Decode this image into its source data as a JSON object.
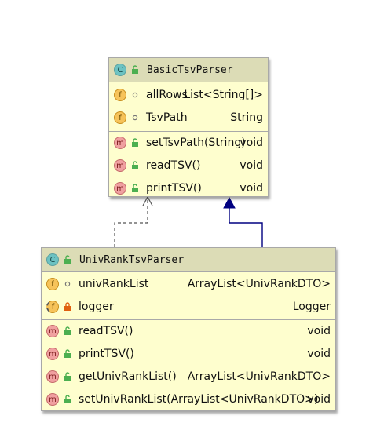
{
  "classes": {
    "basic": {
      "kind": "C",
      "name": "BasicTsvParser",
      "fields": [
        {
          "badge": "f",
          "visibility": "package",
          "name": "allRows",
          "type": "List<String[]>"
        },
        {
          "badge": "f",
          "visibility": "package",
          "name": "TsvPath",
          "type": "String"
        }
      ],
      "methods": [
        {
          "badge": "m",
          "visibility": "public",
          "name": "setTsvPath(String)",
          "type": "void"
        },
        {
          "badge": "m",
          "visibility": "public",
          "name": "readTSV()",
          "type": "void"
        },
        {
          "badge": "m",
          "visibility": "public",
          "name": "printTSV()",
          "type": "void"
        }
      ]
    },
    "univ": {
      "kind": "C",
      "name": "UnivRankTsvParser",
      "fields": [
        {
          "badge": "f",
          "visibility": "package",
          "name": "univRankList",
          "type": "ArrayList<UnivRankDTO>"
        },
        {
          "badge": "f",
          "visibility": "private",
          "static": true,
          "name": "logger",
          "type": "Logger"
        }
      ],
      "methods": [
        {
          "badge": "m",
          "visibility": "public",
          "name": "readTSV()",
          "type": "void"
        },
        {
          "badge": "m",
          "visibility": "public",
          "name": "printTSV()",
          "type": "void"
        },
        {
          "badge": "m",
          "visibility": "public",
          "name": "getUnivRankList()",
          "type": "ArrayList<UnivRankDTO>"
        },
        {
          "badge": "m",
          "visibility": "public",
          "name": "setUnivRankList(ArrayList<UnivRankDTO>)",
          "type": "void"
        }
      ]
    }
  },
  "relations": [
    {
      "from": "univ",
      "to": "basic",
      "kind": "dependency",
      "style": "dashed",
      "color": "#555555"
    },
    {
      "from": "univ",
      "to": "basic",
      "kind": "inheritance",
      "style": "solid",
      "color": "#000080"
    }
  ],
  "colors": {
    "box_fill": "#fefece",
    "header_fill": "#dcdcb6",
    "border": "#a8a8a8",
    "inheritance": "#000080",
    "public": "#4caf50",
    "private": "#e06010"
  }
}
